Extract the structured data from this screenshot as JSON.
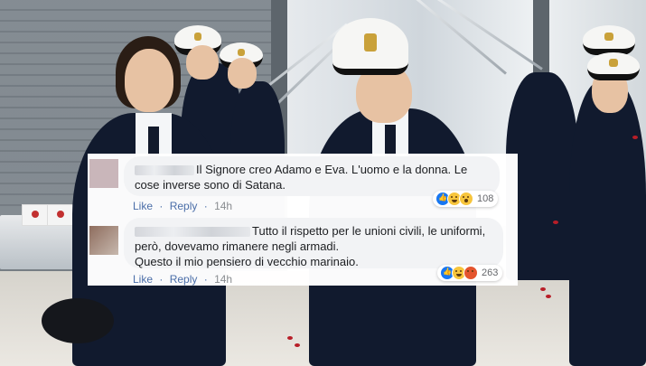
{
  "comments": [
    {
      "author_redacted": true,
      "text_lines": [
        "Il Signore creo Adamo e Eva. L'uomo e la donna. Le",
        "cose inverse sono di Satana."
      ],
      "like_label": "Like",
      "reply_label": "Reply",
      "separator": "·",
      "time": "14h",
      "reactions": [
        "like-icon",
        "haha-icon",
        "wow-icon"
      ],
      "reaction_count": "108"
    },
    {
      "author_redacted": true,
      "text_lines": [
        "Tutto il rispetto per le unioni civili, le uniformi,",
        "però, dovevamo rimanere negli armadi.",
        "Questo il mio pensiero di vecchio marinaio."
      ],
      "like_label": "Like",
      "reply_label": "Reply",
      "separator": "·",
      "time": "14h",
      "reactions": [
        "like-icon",
        "haha-icon",
        "angry-icon"
      ],
      "reaction_count": "263"
    }
  ],
  "colors": {
    "link": "#4b6ea8",
    "bubble": "#f2f3f5",
    "like_blue": "#1877f2",
    "uniform": "#111a2e"
  }
}
